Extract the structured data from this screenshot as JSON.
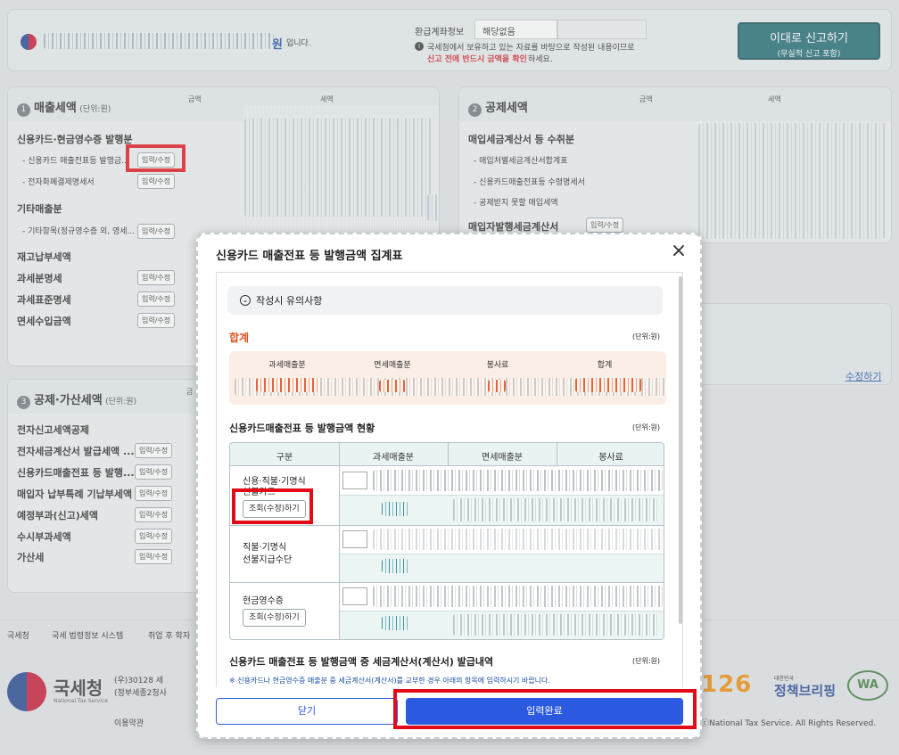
{
  "top_bar": {
    "name_suffix": "원",
    "name_tail": "입니다.",
    "refund_account_label": "환급계좌정보",
    "refund_account_value": "해당없음",
    "notice_line1": "국세청에서 보유하고 있는 자료를 바탕으로 작성된 내용이므로",
    "notice_line2_red": "신고 전에 반드시 금액을 확인",
    "notice_line2_tail": "하세요.",
    "file_button_line1": "이대로 신고하기",
    "file_button_line2": "(무실적 신고 포함)"
  },
  "sales_panel": {
    "number": "1",
    "title": "매출세액",
    "unit": "(단위:원)",
    "col_amount": "금액",
    "col_tax": "세액",
    "groups": [
      {
        "label": "신용카드·현금영수증 발행분"
      },
      {
        "label": "- 신용카드 매출전표등 발행금...",
        "button": "입력/수정"
      },
      {
        "label": "- 전자화폐결제명세서",
        "button": "입력/수정"
      },
      {
        "label": "기타매출분"
      },
      {
        "label": "- 기타항목(정규영수증 외, 영세...",
        "button": "입력/수정"
      },
      {
        "label": "재고납부세액"
      },
      {
        "label": "과세분명세",
        "button": "입력/수정"
      },
      {
        "label": "과세표준명세",
        "button": "입력/수정"
      },
      {
        "label": "면세수입금액",
        "button": "입력/수정"
      }
    ]
  },
  "deduction_panel": {
    "number": "2",
    "title": "공제세액",
    "col_amount": "금액",
    "col_tax": "세액",
    "rows": [
      {
        "label": "매입세금계산서 등 수취분"
      },
      {
        "label": "- 매입처별세금계산서합계표"
      },
      {
        "label": "- 신용카드매출전표등 수령명세서"
      },
      {
        "label": "- 공제받지 못할 매입세액"
      },
      {
        "label": "매입자발행세금계산서",
        "button": "입력/수정"
      }
    ],
    "edit_link": "수정하기"
  },
  "addition_panel": {
    "number": "3",
    "title": "공제·가산세액",
    "unit": "(단위:원)",
    "col_amount": "금",
    "rows": [
      {
        "label": "전자신고세액공제"
      },
      {
        "label": "전자세금계산서 발급세액 ...",
        "button": "입력/수정"
      },
      {
        "label": "신용카드매출전표 등 발행...",
        "button": "입력/수정"
      },
      {
        "label": "매입자 납부특례 기납부세액",
        "button": "입력/수정"
      },
      {
        "label": "예정부과(신고)세액",
        "button": "입력/수정"
      },
      {
        "label": "수시부과세액",
        "button": "입력/수정"
      },
      {
        "label": "가산세",
        "button": "입력/수정"
      }
    ]
  },
  "footer": {
    "links": [
      "국세청",
      "국세 법령정보 시스템",
      "취업 후 학자"
    ],
    "logo_text": "국세청",
    "logo_sub": "National Tax Service",
    "address1": "(우)30128 세",
    "address2": "(정부세종2청사",
    "terms": "이용약관",
    "copyright": "ⓒNational Tax Service. All Rights Reserved.",
    "badge_126": "126",
    "policy_small": "대한민국",
    "policy_text": "정책브리핑",
    "wa_text": "WA"
  },
  "modal": {
    "title": "신용카드 매출전표 등 발행금액 집계표",
    "notice_toggle": "작성시 유의사항",
    "total_title": "합계",
    "unit": "(단위:원)",
    "total_headers": [
      "과세매출분",
      "면세매출분",
      "봉사료",
      "합계"
    ],
    "status_title": "신용카드매출전표 등 발행금액 현황",
    "table_headers": [
      "구분",
      "과세매출분",
      "면세매출분",
      "봉사료"
    ],
    "table_rows": [
      {
        "label_line1": "신용·직불·기명식",
        "label_line2": "선불카드",
        "button": "조회(수정)하기"
      },
      {
        "label_line1": "직불·기명식",
        "label_line2": "선불지급수단"
      },
      {
        "label_line1": "현금영수증",
        "label_line2": "",
        "button": "조회(수정)하기"
      }
    ],
    "invoice_title": "신용카드 매출전표 등 발행금액 중 세금계산서(계산서) 발급내역",
    "invoice_note": "※ 신용카드나 현금영수증 매출분 중 세금계산서(계산서)를 교부한 경우 아래의 항목에 입력하시기 바랍니다.",
    "close_button": "닫기",
    "complete_button": "입력완료"
  },
  "colors": {
    "primary_blue": "#2b59e0",
    "file_button_teal": "#1a6670",
    "highlight_red": "#e30b17",
    "total_orange": "#e1531e"
  }
}
